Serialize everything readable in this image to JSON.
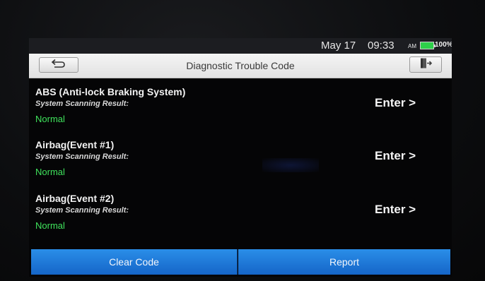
{
  "status": {
    "date": "May 17",
    "time": "09:33",
    "ampm": "AM",
    "battery": "100%",
    "battery_color": "#2ed04a"
  },
  "header": {
    "title": "Diagnostic Trouble Code",
    "back_icon": "back-arrow-icon",
    "exit_icon": "exit-door-icon"
  },
  "systems": [
    {
      "name": "ABS (Anti-lock Braking System)",
      "subtitle": "System Scanning Result:",
      "status": "Normal",
      "action": "Enter >"
    },
    {
      "name": "Airbag(Event #1)",
      "subtitle": "System Scanning Result:",
      "status": "Normal",
      "action": "Enter >"
    },
    {
      "name": "Airbag(Event #2)",
      "subtitle": "System Scanning Result:",
      "status": "Normal",
      "action": "Enter >"
    }
  ],
  "footer": {
    "clear_label": "Clear Code",
    "report_label": "Report",
    "accent": "#1e7ad8"
  },
  "colors": {
    "status_normal": "#3fe35c",
    "background": "#050506"
  }
}
